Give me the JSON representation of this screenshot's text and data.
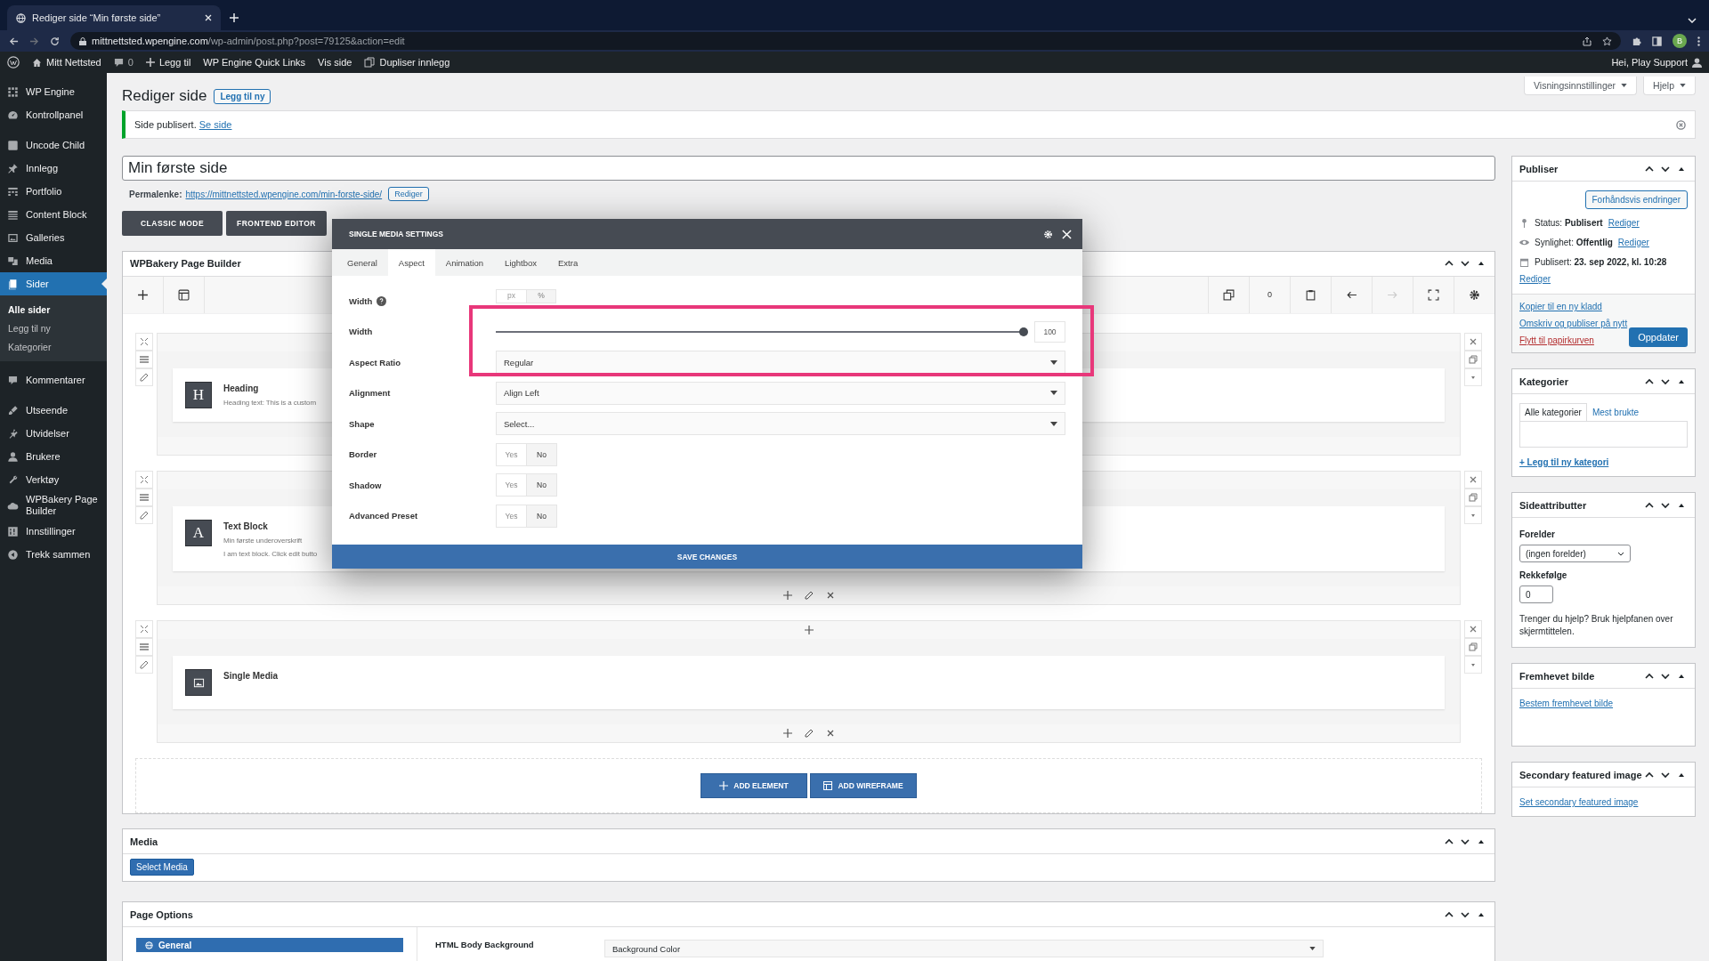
{
  "browser": {
    "tab_title": "Rediger side “Min første side”",
    "url_host": "mittnettsted.wpengine.com",
    "url_path": "/wp-admin/post.php?post=79125&action=edit",
    "profile_initial": "B"
  },
  "admin_bar": {
    "site": "Mitt Nettsted",
    "comments": "0",
    "items": [
      "Legg til",
      "WP Engine Quick Links",
      "Vis side",
      "Dupliser innlegg"
    ],
    "greeting": "Hei, Play Support"
  },
  "sidebar": {
    "groups": [
      [
        {
          "label": "WP Engine",
          "selected": false
        },
        {
          "label": "Kontrollpanel",
          "selected": false
        }
      ],
      [
        {
          "label": "Uncode Child",
          "selected": false
        },
        {
          "label": "Innlegg",
          "selected": false
        },
        {
          "label": "Portfolio",
          "selected": false
        },
        {
          "label": "Content Block",
          "selected": false
        },
        {
          "label": "Galleries",
          "selected": false
        },
        {
          "label": "Media",
          "selected": false
        },
        {
          "label": "Sider",
          "selected": true,
          "children": [
            {
              "label": "Alle sider",
              "selected": true
            },
            {
              "label": "Legg til ny",
              "selected": false
            },
            {
              "label": "Kategorier",
              "selected": false
            }
          ]
        }
      ],
      [
        {
          "label": "Kommentarer",
          "selected": false
        }
      ],
      [
        {
          "label": "Utseende",
          "selected": false
        },
        {
          "label": "Utvidelser",
          "selected": false
        },
        {
          "label": "Brukere",
          "selected": false
        },
        {
          "label": "Verktøy",
          "selected": false
        },
        {
          "label": "WPBakery Page Builder",
          "selected": false
        },
        {
          "label": "Innstillinger",
          "selected": false
        },
        {
          "label": "Trekk sammen",
          "selected": false
        }
      ]
    ]
  },
  "header": {
    "title": "Rediger side",
    "add_new": "Legg til ny",
    "screen_options": "Visningsinnstillinger",
    "help": "Hjelp"
  },
  "notice": {
    "text": "Side publisert.",
    "link": "Se side"
  },
  "post": {
    "title": "Min første side",
    "permalink_label": "Permalenke:",
    "permalink": "https://mittnettsted.wpengine.com/min-forste-side/",
    "permalink_edit": "Rediger"
  },
  "mode_buttons": [
    "CLASSIC MODE",
    "FRONTEND EDITOR"
  ],
  "builder": {
    "title": "WPBakery Page Builder",
    "count": "0",
    "rows": [
      {
        "kind": "heading",
        "glyph": "H",
        "title": "Heading",
        "lines": [
          "Heading text: This is a custom"
        ]
      },
      {
        "kind": "text",
        "glyph": "A",
        "title": "Text Block",
        "lines": [
          "Min første underoverskrift",
          "I am text block. Click edit butto"
        ],
        "bottom_tools": true
      },
      {
        "kind": "media",
        "title": "Single Media",
        "lines": [],
        "top_add": true,
        "bottom_tools": true
      }
    ],
    "add_element": "ADD ELEMENT",
    "add_wireframe": "ADD WIREFRAME"
  },
  "media_box": {
    "title": "Media",
    "button": "Select Media"
  },
  "page_options": {
    "title": "Page Options",
    "tabs": [
      {
        "label": "General",
        "selected": true
      }
    ],
    "field_label": "HTML Body Background",
    "field_value": "Background Color"
  },
  "modal": {
    "title": "SINGLE MEDIA SETTINGS",
    "tabs": [
      {
        "label": "General",
        "selected": false
      },
      {
        "label": "Aspect",
        "selected": true
      },
      {
        "label": "Animation",
        "selected": false
      },
      {
        "label": "Lightbox",
        "selected": false
      },
      {
        "label": "Extra",
        "selected": false
      }
    ],
    "fields": [
      {
        "kind": "units",
        "label": "Width",
        "help": true,
        "options": [
          {
            "label": "px",
            "selected": false
          },
          {
            "label": "%",
            "selected": true
          }
        ]
      },
      {
        "kind": "slider",
        "label": "Width",
        "help": false,
        "level": 1,
        "value": "100"
      },
      {
        "kind": "select",
        "label": "Aspect Ratio",
        "help": false,
        "value": "Regular"
      },
      {
        "kind": "select",
        "label": "Alignment",
        "help": false,
        "value": "Align Left"
      },
      {
        "kind": "select",
        "label": "Shape",
        "help": false,
        "value": "Select..."
      },
      {
        "kind": "toggle",
        "label": "Border",
        "help": false,
        "options": [
          {
            "label": "Yes",
            "selected": false
          },
          {
            "label": "No",
            "selected": true
          }
        ]
      },
      {
        "kind": "toggle",
        "label": "Shadow",
        "help": false,
        "options": [
          {
            "label": "Yes",
            "selected": false
          },
          {
            "label": "No",
            "selected": true
          }
        ]
      },
      {
        "kind": "toggle",
        "label": "Advanced Preset",
        "help": false,
        "options": [
          {
            "label": "Yes",
            "selected": false
          },
          {
            "label": "No",
            "selected": true
          }
        ]
      }
    ],
    "save": "SAVE CHANGES"
  },
  "publish": {
    "title": "Publiser",
    "preview": "Forhåndsvis endringer",
    "meta": [
      {
        "kind": "status",
        "text": "Status: **Publisert**",
        "link": "Rediger"
      },
      {
        "kind": "visibility",
        "text": "Synlighet: **Offentlig**",
        "link": "Rediger"
      },
      {
        "kind": "date",
        "text": "Publisert: **23. sep 2022, kl. 10:28**",
        "link": "Rediger"
      }
    ],
    "actions": [
      {
        "kind": "link",
        "text": "Kopier til en ny kladd"
      },
      {
        "kind": "link",
        "text": "Omskriv og publiser på nytt"
      },
      {
        "kind": "danger",
        "text": "Flytt til papirkurven"
      }
    ],
    "update": "Oppdater"
  },
  "categories": {
    "title": "Kategorier",
    "tabs": [
      {
        "label": "Alle kategorier",
        "selected": true
      },
      {
        "label": "Mest brukte",
        "selected": false
      }
    ],
    "add": "+ Legg til ny kategori"
  },
  "attributes": {
    "title": "Sideattributter",
    "parent_label": "Forelder",
    "parent_value": "(ingen forelder)",
    "order_label": "Rekkefølge",
    "order_value": "0",
    "help": "Trenger du hjelp? Bruk hjelpfanen over skjermtittelen."
  },
  "featured": {
    "title": "Fremhevet bilde",
    "link": "Bestem fremhevet bilde"
  },
  "secondary": {
    "title": "Secondary featured image",
    "link": "Set secondary featured image"
  }
}
